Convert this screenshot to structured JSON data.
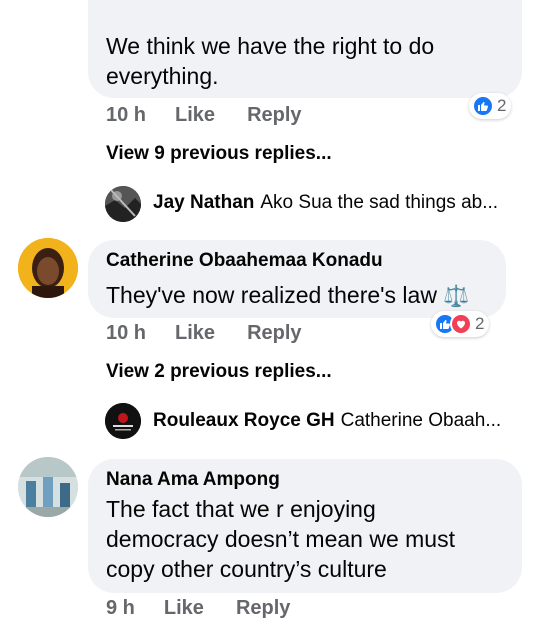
{
  "colors": {
    "bubble_bg": "#f0f2f5",
    "meta_text": "#65676b",
    "like_blue": "#1877f2",
    "love_red": "#f33e58"
  },
  "comment1": {
    "text_line1": "We think we have the right to do",
    "text_line2": "everything.",
    "time": "10 h",
    "like": "Like",
    "reply": "Reply",
    "reaction_count": "2",
    "reaction_icons": [
      "like-icon"
    ],
    "view_replies": "View 9 previous replies...",
    "latest_reply": {
      "name": "Jay Nathan",
      "text": "Ako Sua the sad things ab..."
    }
  },
  "comment2": {
    "name": "Catherine Obaahemaa Konadu",
    "text": "They've now realized there's law",
    "text_emoji": "⚖️",
    "time": "10 h",
    "like": "Like",
    "reply": "Reply",
    "reaction_count": "2",
    "reaction_icons": [
      "like-icon",
      "love-icon"
    ],
    "view_replies": "View 2 previous replies...",
    "latest_reply": {
      "name": "Rouleaux Royce GH",
      "text": "Catherine Obaah..."
    }
  },
  "comment3": {
    "name": "Nana Ama Ampong",
    "text_line1": "The fact that we r enjoying",
    "text_line2": "democracy doesn’t mean we must",
    "text_line3": "copy other country’s culture",
    "time": "9 h",
    "like": "Like",
    "reply": "Reply"
  }
}
